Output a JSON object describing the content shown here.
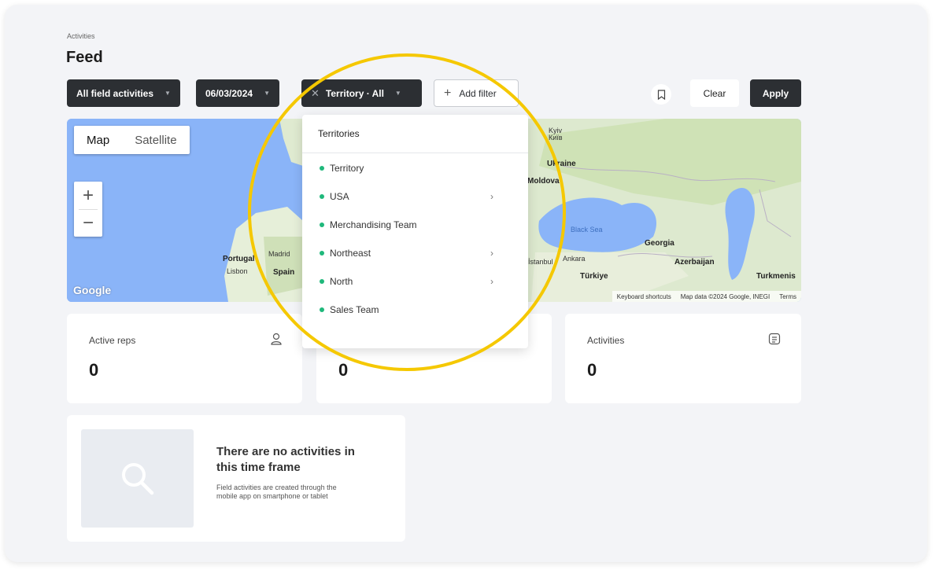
{
  "breadcrumb": "Activities",
  "page_title": "Feed",
  "filters": {
    "activity_type": "All field activities",
    "date": "06/03/2024",
    "territory": "Territory · All",
    "add_filter": "Add filter"
  },
  "actions": {
    "clear": "Clear",
    "apply": "Apply"
  },
  "map": {
    "tab_map": "Map",
    "tab_satellite": "Satellite",
    "zoom_in": "+",
    "zoom_out": "−",
    "labels": {
      "portugal": "Portugal",
      "madrid": "Madrid",
      "spain": "Spain",
      "lisbon": "Lisbon",
      "kyiv": "Kyiv",
      "kyiv_local": "Київ",
      "ukraine": "Ukraine",
      "moldova": "Moldova",
      "black_sea": "Black Sea",
      "georgia": "Georgia",
      "istanbul": "İstanbul",
      "ankara": "Ankara",
      "turkiye": "Türkiye",
      "azerbaijan": "Azerbaijan",
      "turkmenistan": "Turkmenis"
    },
    "google": "Google",
    "keyboard_shortcuts": "Keyboard shortcuts",
    "map_data": "Map data ©2024 Google, INEGI",
    "terms": "Terms"
  },
  "territory_dropdown": {
    "header": "Territories",
    "items": [
      {
        "label": "Territory",
        "has_children": false
      },
      {
        "label": "USA",
        "has_children": true
      },
      {
        "label": "Merchandising Team",
        "has_children": false
      },
      {
        "label": "Northeast",
        "has_children": true
      },
      {
        "label": "North",
        "has_children": true
      },
      {
        "label": "Sales Team",
        "has_children": false
      }
    ]
  },
  "stats": {
    "active_reps_label": "Active reps",
    "active_reps_value": "0",
    "middle_value": "0",
    "activities_label": "Activities",
    "activities_value": "0"
  },
  "empty_state": {
    "title": "There are no activities in this time frame",
    "description": "Field activities are created through the mobile app on smartphone or tablet"
  },
  "colors": {
    "dark_chip": "#2c2f33",
    "status_dot": "#1fb87b",
    "highlight": "#f5c800"
  }
}
